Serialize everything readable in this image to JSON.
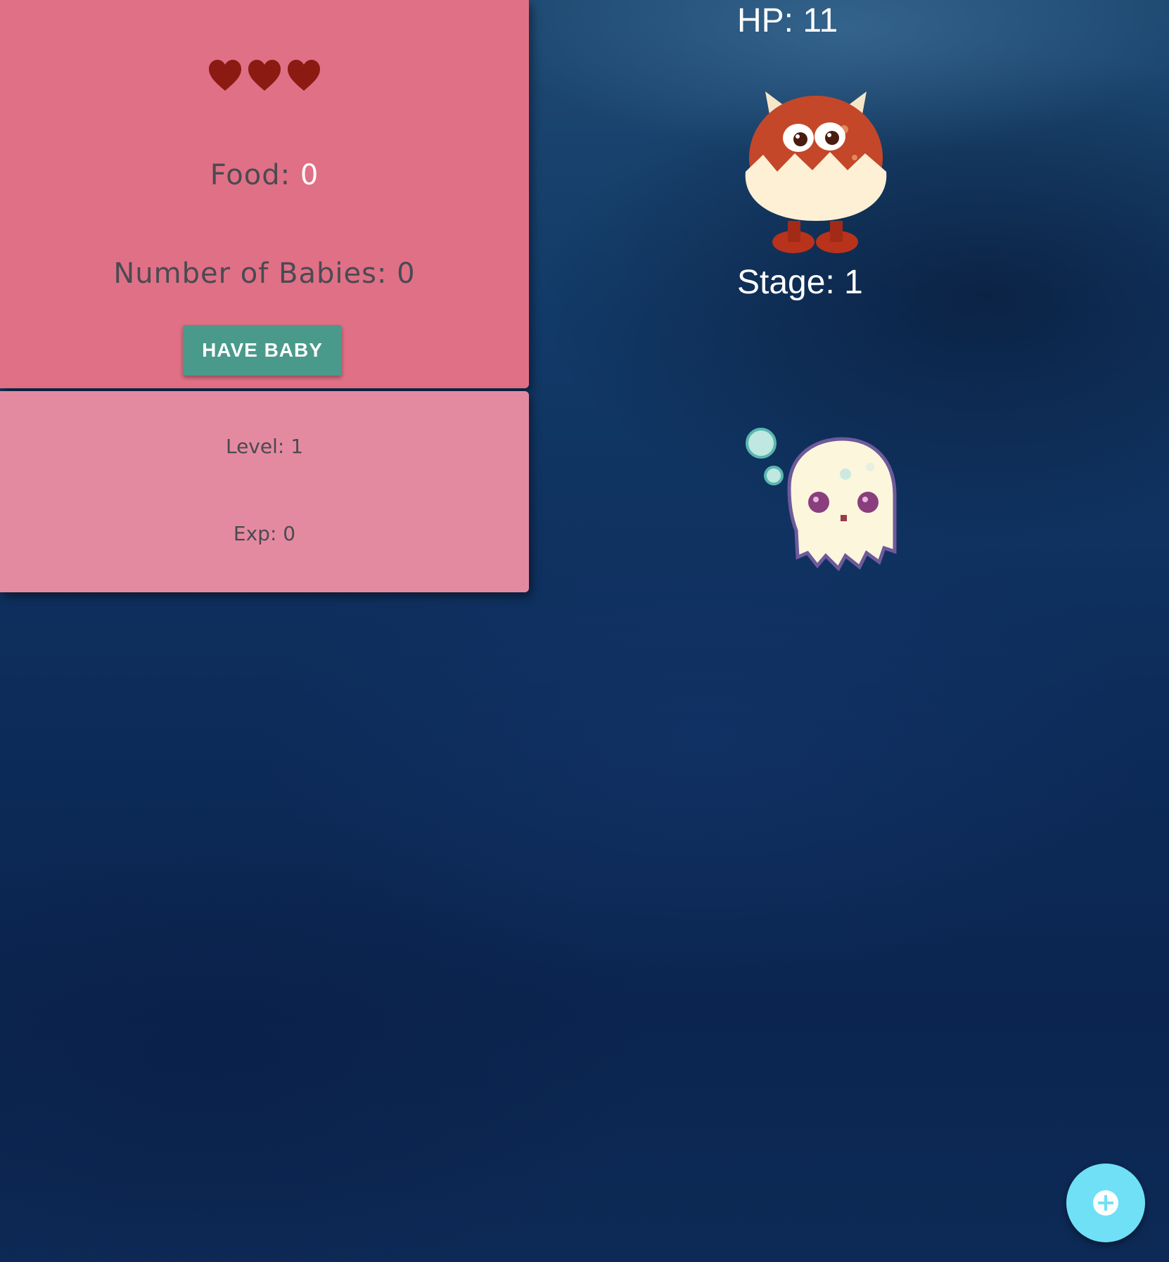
{
  "stats": {
    "lives_filled": 3,
    "food_label": "Food:",
    "food_value": "0",
    "babies_label": "Number of Babies:",
    "babies_value": "0",
    "have_baby_button": "HAVE BABY",
    "level_text": "Level: 1",
    "exp_text": "Exp: 0"
  },
  "monster": {
    "hp_text": "HP: 11",
    "stage_text": "Stage: 1",
    "sprite": "horned-egg-monster",
    "companion_sprite": "pixel-ghost"
  },
  "fab": {
    "icon": "plus-icon"
  },
  "colors": {
    "panel_top": "#e07086",
    "panel_bottom": "#e48aa0",
    "heart": "#8b1a12",
    "button": "#4a9a8b",
    "fab": "#6fe0f6",
    "background": "#0d2c5a"
  }
}
